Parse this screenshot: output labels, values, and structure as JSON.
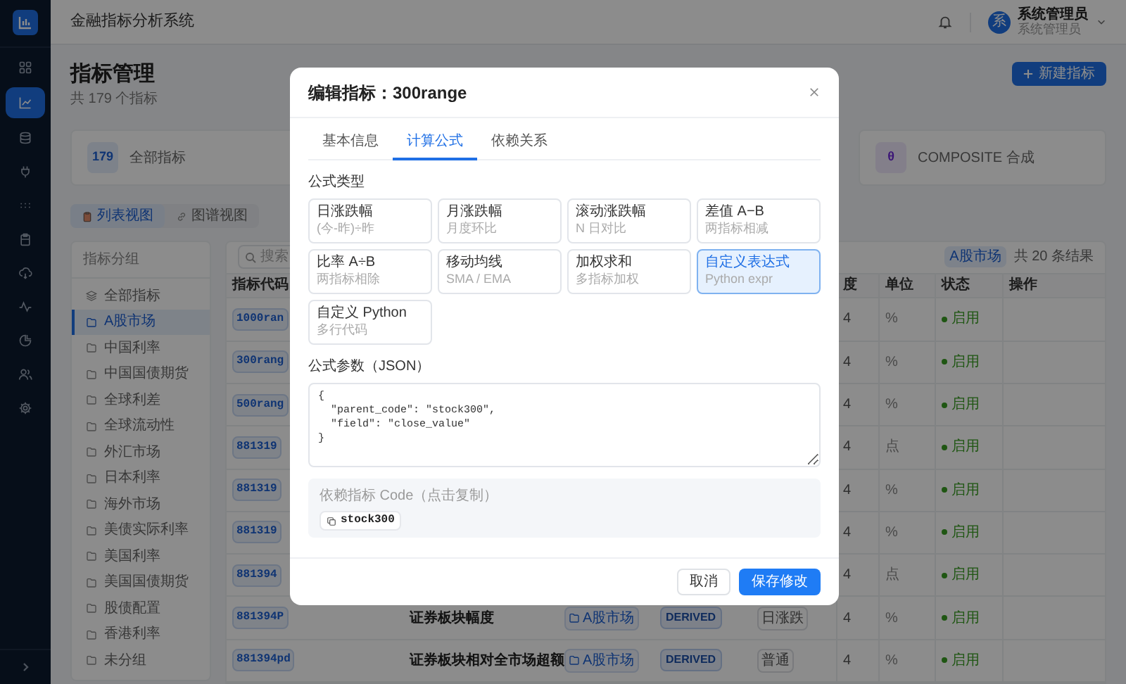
{
  "app": {
    "title": "金融指标分析系统"
  },
  "nav": [
    {
      "selected": false
    },
    {
      "selected": true
    },
    {
      "selected": false
    },
    {
      "selected": false
    },
    {
      "selected": false
    },
    {
      "selected": false
    },
    {
      "selected": false
    },
    {
      "selected": false
    },
    {
      "selected": false
    },
    {
      "selected": false
    },
    {
      "selected": false
    }
  ],
  "user": {
    "avatar": "系",
    "name": "系统管理员",
    "role": "系统管理员"
  },
  "page": {
    "title": "指标管理",
    "subtitle": "共 179 个指标",
    "new_button": "新建指标"
  },
  "stat_cards": [
    {
      "count": "179",
      "label": "全部指标",
      "kind": "total"
    },
    {
      "count": "θ",
      "label": "COMPOSITE 合成",
      "kind": "composite"
    }
  ],
  "view_tabs": [
    {
      "label": "列表视图",
      "selected": true
    },
    {
      "label": "图谱视图",
      "selected": false
    }
  ],
  "groups": {
    "title": "指标分组",
    "items": [
      {
        "label": "全部指标",
        "kind": "all",
        "selected": false
      },
      {
        "label": "A股市场",
        "kind": "folder",
        "selected": true
      },
      {
        "label": "中国利率",
        "kind": "folder",
        "selected": false
      },
      {
        "label": "中国国债期货",
        "kind": "folder",
        "selected": false
      },
      {
        "label": "全球利差",
        "kind": "folder",
        "selected": false
      },
      {
        "label": "全球流动性",
        "kind": "folder",
        "selected": false
      },
      {
        "label": "外汇市场",
        "kind": "folder",
        "selected": false
      },
      {
        "label": "日本利率",
        "kind": "folder",
        "selected": false
      },
      {
        "label": "海外市场",
        "kind": "folder",
        "selected": false
      },
      {
        "label": "美债实际利率",
        "kind": "folder",
        "selected": false
      },
      {
        "label": "美国利率",
        "kind": "folder",
        "selected": false
      },
      {
        "label": "美国国债期货",
        "kind": "folder",
        "selected": false
      },
      {
        "label": "股债配置",
        "kind": "folder",
        "selected": false
      },
      {
        "label": "香港利率",
        "kind": "folder",
        "selected": false
      },
      {
        "label": "未分组",
        "kind": "folder",
        "selected": false
      }
    ]
  },
  "search": {
    "placeholder": "搜索"
  },
  "filter_tag": "A股市场",
  "result_count": "共 20 条结果",
  "table": {
    "columns": [
      "指标代码",
      "度",
      "单位",
      "状态",
      "操作"
    ],
    "rows": [
      {
        "code": "1000ran",
        "precision": "4",
        "unit": "%",
        "status": "启用",
        "enabled": true
      },
      {
        "code": "300rang",
        "precision": "4",
        "unit": "%",
        "status": "启用",
        "enabled": true
      },
      {
        "code": "500rang",
        "precision": "4",
        "unit": "%",
        "status": "启用",
        "enabled": true
      },
      {
        "code": "881319",
        "precision": "4",
        "unit": "点",
        "status": "启用",
        "enabled": true
      },
      {
        "code": "881319",
        "precision": "4",
        "unit": "%",
        "status": "启用",
        "enabled": true
      },
      {
        "code": "881319",
        "precision": "4",
        "unit": "%",
        "status": "启用",
        "enabled": true
      },
      {
        "code": "881394",
        "precision": "4",
        "unit": "点",
        "status": "启用",
        "enabled": true
      },
      {
        "code": "881394P",
        "name": "证券板块幅度",
        "group": "A股市场",
        "type": "DERIVED",
        "subtype": "日涨跌",
        "precision": "4",
        "unit": "%",
        "status": "启用",
        "enabled": true
      },
      {
        "code": "881394pd",
        "name": "证券板块相对全市场超额",
        "group": "A股市场",
        "type": "DERIVED",
        "subtype": "普通",
        "precision": "4",
        "unit": "%",
        "status": "启用",
        "enabled": true
      }
    ]
  },
  "modal": {
    "title": "编辑指标：300range",
    "tabs": [
      {
        "label": "基本信息",
        "selected": false
      },
      {
        "label": "计算公式",
        "selected": true
      },
      {
        "label": "依赖关系",
        "selected": false
      }
    ],
    "formula_type_label": "公式类型",
    "formula_types": [
      {
        "name": "日涨跌幅",
        "desc": "(今-昨)÷昨",
        "selected": false
      },
      {
        "name": "月涨跌幅",
        "desc": "月度环比",
        "selected": false
      },
      {
        "name": "滚动涨跌幅",
        "desc": "N 日对比",
        "selected": false
      },
      {
        "name": "差值 A−B",
        "desc": "两指标相减",
        "selected": false
      },
      {
        "name": "比率 A÷B",
        "desc": "两指标相除",
        "selected": false
      },
      {
        "name": "移动均线",
        "desc": "SMA / EMA",
        "selected": false
      },
      {
        "name": "加权求和",
        "desc": "多指标加权",
        "selected": false
      },
      {
        "name": "自定义表达式",
        "desc": "Python expr",
        "selected": true
      },
      {
        "name": "自定义 Python",
        "desc": "多行代码",
        "selected": false
      }
    ],
    "params_label": "公式参数（JSON）",
    "params": "{\n  \"parent_code\": \"stock300\",\n  \"field\": \"close_value\"\n}",
    "deps_label": "依赖指标 Code（点击复制）",
    "deps": [
      "stock300"
    ],
    "cancel": "取消",
    "save": "保存修改"
  }
}
